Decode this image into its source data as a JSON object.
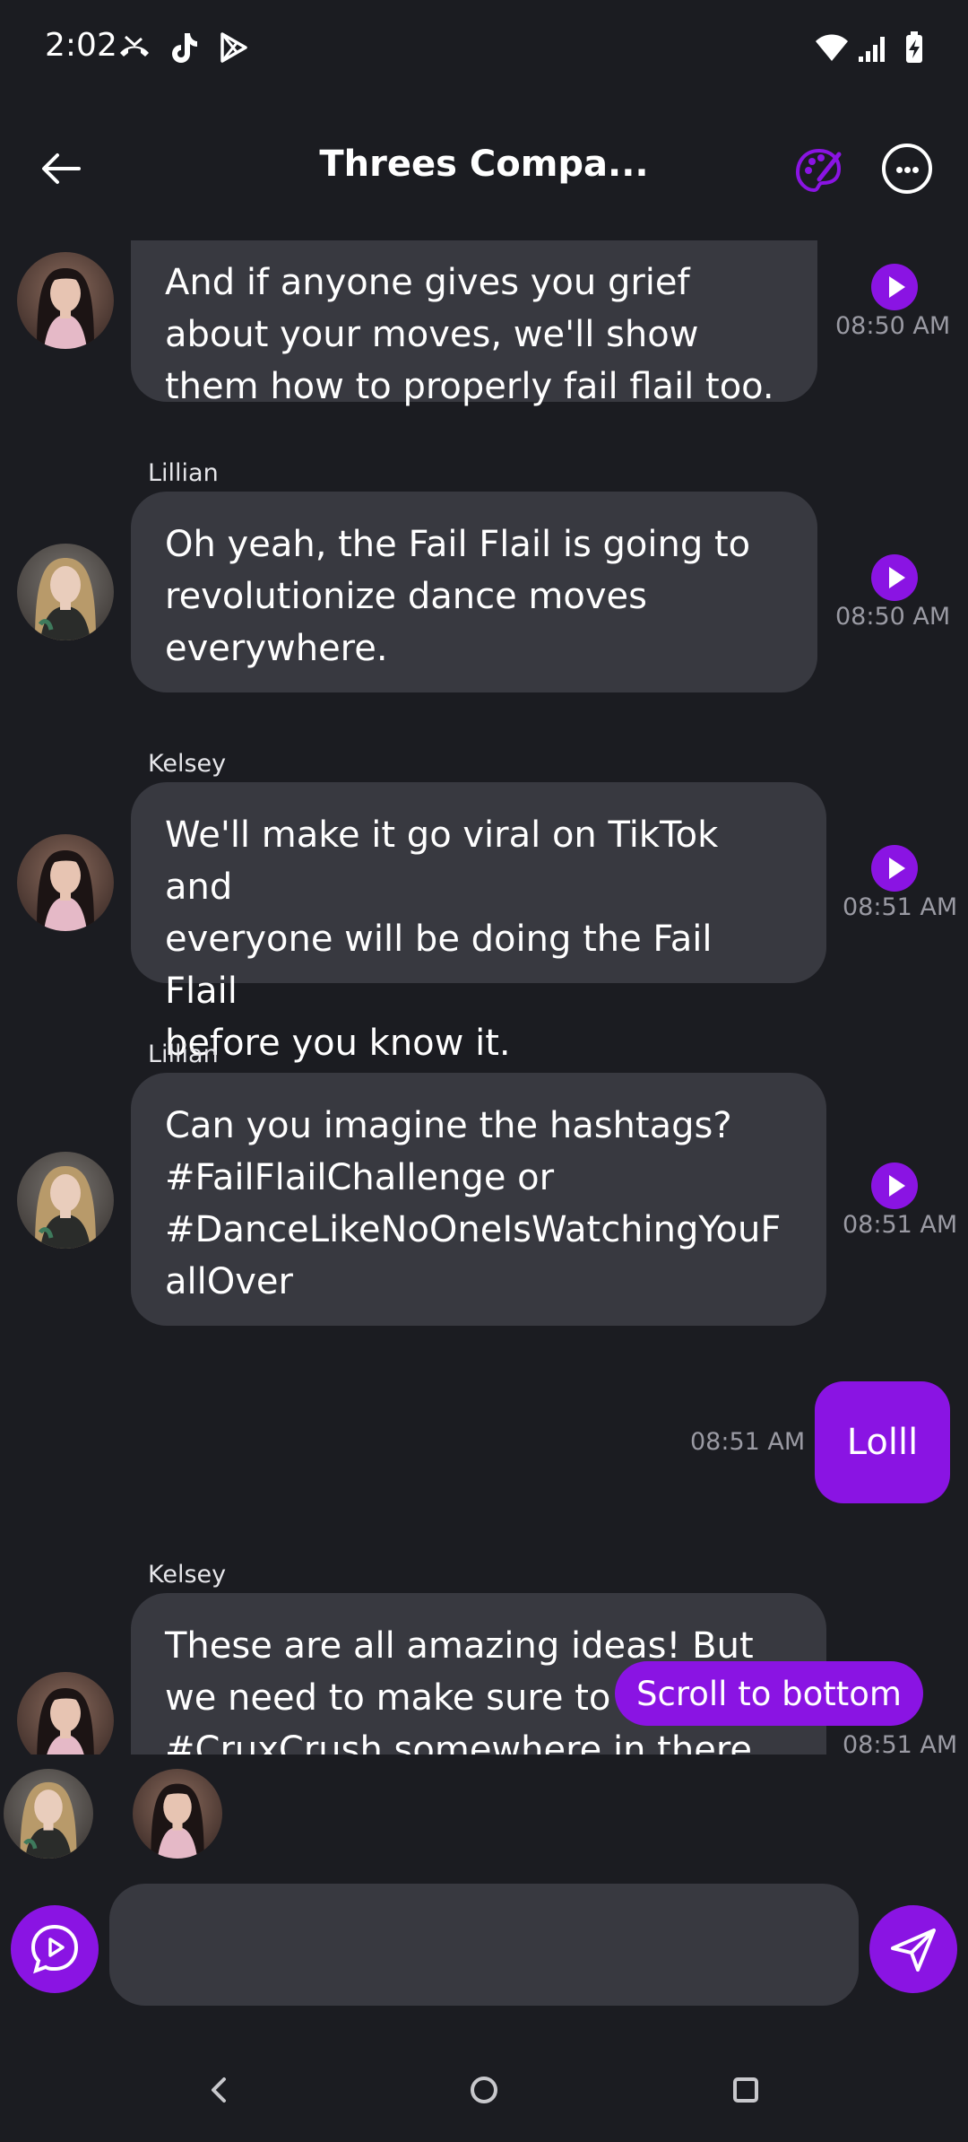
{
  "status_bar": {
    "time": "2:02",
    "left_icons": [
      "missed-call-icon",
      "tiktok-icon",
      "play-store-icon"
    ],
    "right_icons": [
      "wifi-icon",
      "signal-icon",
      "battery-charging-icon"
    ]
  },
  "header": {
    "title": "Threes Compa...",
    "back_icon": "arrow-left-icon",
    "palette_icon": "palette-icon",
    "more_icon": "more-horizontal-icon",
    "accent_color": "#8a14e3"
  },
  "messages": [
    {
      "sender": "",
      "avatar": "kelsey",
      "text_lines": [
        "And if anyone gives you grief",
        "about your moves, we'll show",
        "them how to properly fail flail too."
      ],
      "time": "08:50 AM"
    },
    {
      "sender": "Lillian",
      "avatar": "lillian",
      "text_lines": [
        "Oh yeah, the Fail Flail is going to",
        "revolutionize dance moves",
        "everywhere."
      ],
      "time": "08:50 AM"
    },
    {
      "sender": "Kelsey",
      "avatar": "kelsey",
      "text_lines": [
        "We'll make it go viral on TikTok and",
        "everyone will be doing the Fail Flail",
        "before you know it."
      ],
      "time": "08:51 AM"
    },
    {
      "sender": "Lillian",
      "avatar": "lillian",
      "text_lines": [
        "Can you imagine the hashtags?",
        "#FailFlailChallenge or",
        "#DanceLikeNoOneIsWatchingYouF",
        "allOver"
      ],
      "time": "08:51 AM"
    },
    {
      "sender": "me",
      "text": "Lolll",
      "time": "08:51 AM"
    },
    {
      "sender": "Kelsey",
      "avatar": "kelsey",
      "text_lines": [
        "These are all amazing ideas! But",
        "we need to make sure to",
        "#CruxCrush somewhere in there"
      ],
      "time": "08:51 AM"
    }
  ],
  "scroll_button": {
    "label": "Scroll to bottom"
  },
  "typing_avatars": [
    "lillian",
    "kelsey"
  ],
  "composer": {
    "placeholder": "",
    "value": "",
    "voice_icon": "voice-chat-icon",
    "send_icon": "send-icon"
  },
  "nav_bar": {
    "icons": [
      "nav-back-icon",
      "nav-home-icon",
      "nav-recents-icon"
    ]
  }
}
